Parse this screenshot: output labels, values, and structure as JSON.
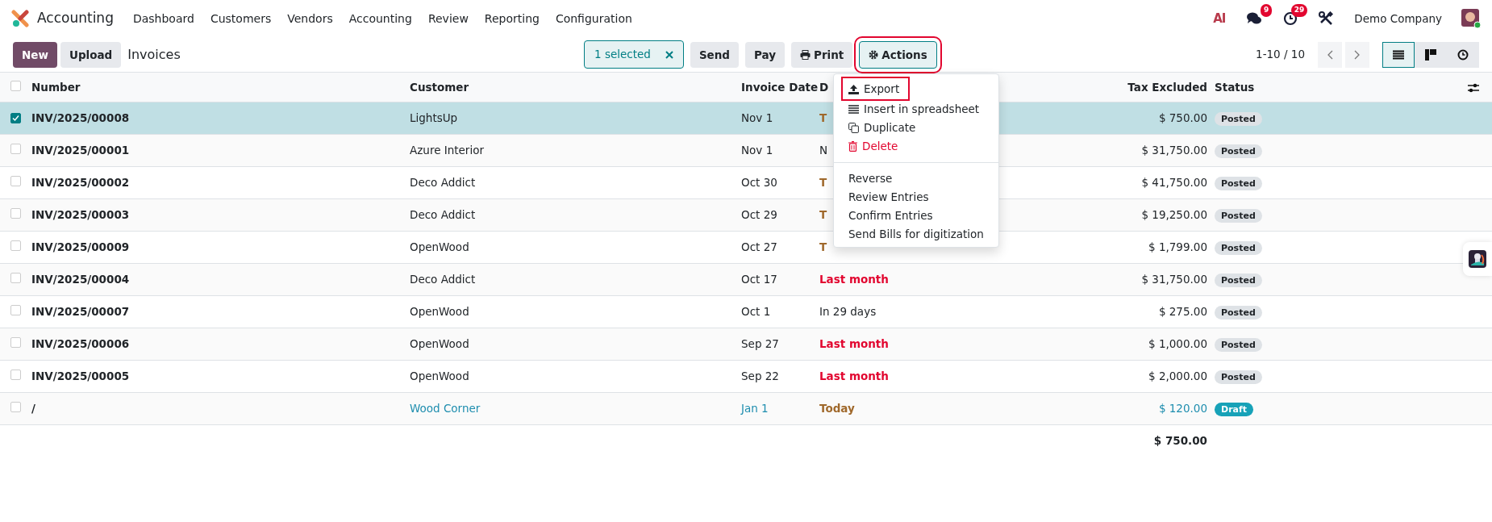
{
  "navbar": {
    "app_name": "Accounting",
    "menu": [
      "Dashboard",
      "Customers",
      "Vendors",
      "Accounting",
      "Review",
      "Reporting",
      "Configuration"
    ],
    "ai_label": "AI",
    "messages_count": "9",
    "activities_count": "29",
    "company": "Demo Company"
  },
  "control_panel": {
    "buttons": [
      "New",
      "Upload"
    ],
    "title": "Invoices",
    "selection": "1 selected",
    "actions": [
      {
        "label": "Send",
        "kind": "plain",
        "highlighted": false
      },
      {
        "label": "Pay",
        "kind": "plain",
        "highlighted": false
      },
      {
        "label": "Print",
        "kind": "print",
        "highlighted": false
      },
      {
        "label": "Actions",
        "kind": "gear",
        "highlighted": true
      }
    ],
    "pager": "1-10 / 10",
    "views": [
      {
        "kind": "list",
        "selected": true
      },
      {
        "kind": "kanban",
        "selected": false
      },
      {
        "kind": "activity",
        "selected": false
      }
    ]
  },
  "actions_menu": {
    "groups": [
      [
        {
          "label": "Export",
          "kind": "export",
          "danger": false,
          "highlighted": true
        },
        {
          "label": "Insert in spreadsheet",
          "kind": "list",
          "danger": false,
          "highlighted": false
        },
        {
          "label": "Duplicate",
          "kind": "copy",
          "danger": false,
          "highlighted": false
        },
        {
          "label": "Delete",
          "kind": "trash",
          "danger": true,
          "highlighted": false
        }
      ],
      [
        {
          "label": "Reverse",
          "kind": "plain",
          "danger": false,
          "highlighted": false
        },
        {
          "label": "Review Entries",
          "kind": "plain",
          "danger": false,
          "highlighted": false
        },
        {
          "label": "Confirm Entries",
          "kind": "plain",
          "danger": false,
          "highlighted": false
        },
        {
          "label": "Send Bills for digitization",
          "kind": "plain",
          "danger": false,
          "highlighted": false
        }
      ]
    ]
  },
  "table": {
    "select_all_checked": false,
    "columns": [
      "Number",
      "Customer",
      "Invoice Date",
      "D",
      "Tax Excluded",
      "Status"
    ],
    "rows": [
      {
        "selected": true,
        "number": "INV/2025/00008",
        "customer": "LightsUp",
        "invoice_date": "Nov 1",
        "due": {
          "text": "T",
          "kind": "today"
        },
        "tax_excluded": "$ 750.00",
        "status": {
          "text": "Posted",
          "kind": "posted"
        }
      },
      {
        "selected": false,
        "number": "INV/2025/00001",
        "customer": "Azure Interior",
        "invoice_date": "Nov 1",
        "due": {
          "text": "N",
          "kind": "normal"
        },
        "tax_excluded": "$ 31,750.00",
        "status": {
          "text": "Posted",
          "kind": "posted"
        }
      },
      {
        "selected": false,
        "number": "INV/2025/00002",
        "customer": "Deco Addict",
        "invoice_date": "Oct 30",
        "due": {
          "text": "T",
          "kind": "today"
        },
        "tax_excluded": "$ 41,750.00",
        "status": {
          "text": "Posted",
          "kind": "posted"
        }
      },
      {
        "selected": false,
        "number": "INV/2025/00003",
        "customer": "Deco Addict",
        "invoice_date": "Oct 29",
        "due": {
          "text": "T",
          "kind": "today"
        },
        "tax_excluded": "$ 19,250.00",
        "status": {
          "text": "Posted",
          "kind": "posted"
        }
      },
      {
        "selected": false,
        "number": "INV/2025/00009",
        "customer": "OpenWood",
        "invoice_date": "Oct 27",
        "due": {
          "text": "T",
          "kind": "today"
        },
        "tax_excluded": "$ 1,799.00",
        "status": {
          "text": "Posted",
          "kind": "posted"
        }
      },
      {
        "selected": false,
        "number": "INV/2025/00004",
        "customer": "Deco Addict",
        "invoice_date": "Oct 17",
        "due": {
          "text": "Last month",
          "kind": "overdue"
        },
        "tax_excluded": "$ 31,750.00",
        "status": {
          "text": "Posted",
          "kind": "posted"
        }
      },
      {
        "selected": false,
        "number": "INV/2025/00007",
        "customer": "OpenWood",
        "invoice_date": "Oct 1",
        "due": {
          "text": "In 29 days",
          "kind": "normal"
        },
        "tax_excluded": "$ 275.00",
        "status": {
          "text": "Posted",
          "kind": "posted"
        }
      },
      {
        "selected": false,
        "number": "INV/2025/00006",
        "customer": "OpenWood",
        "invoice_date": "Sep 27",
        "due": {
          "text": "Last month",
          "kind": "overdue"
        },
        "tax_excluded": "$ 1,000.00",
        "status": {
          "text": "Posted",
          "kind": "posted"
        }
      },
      {
        "selected": false,
        "number": "INV/2025/00005",
        "customer": "OpenWood",
        "invoice_date": "Sep 22",
        "due": {
          "text": "Last month",
          "kind": "overdue"
        },
        "tax_excluded": "$ 2,000.00",
        "status": {
          "text": "Posted",
          "kind": "posted"
        }
      },
      {
        "selected": false,
        "number": "/",
        "customer": "Wood Corner",
        "invoice_date": "Jan 1",
        "due": {
          "text": "Today",
          "kind": "today"
        },
        "tax_excluded": "$ 120.00",
        "status": {
          "text": "Draft",
          "kind": "draft"
        }
      }
    ],
    "total": "$ 750.00"
  }
}
